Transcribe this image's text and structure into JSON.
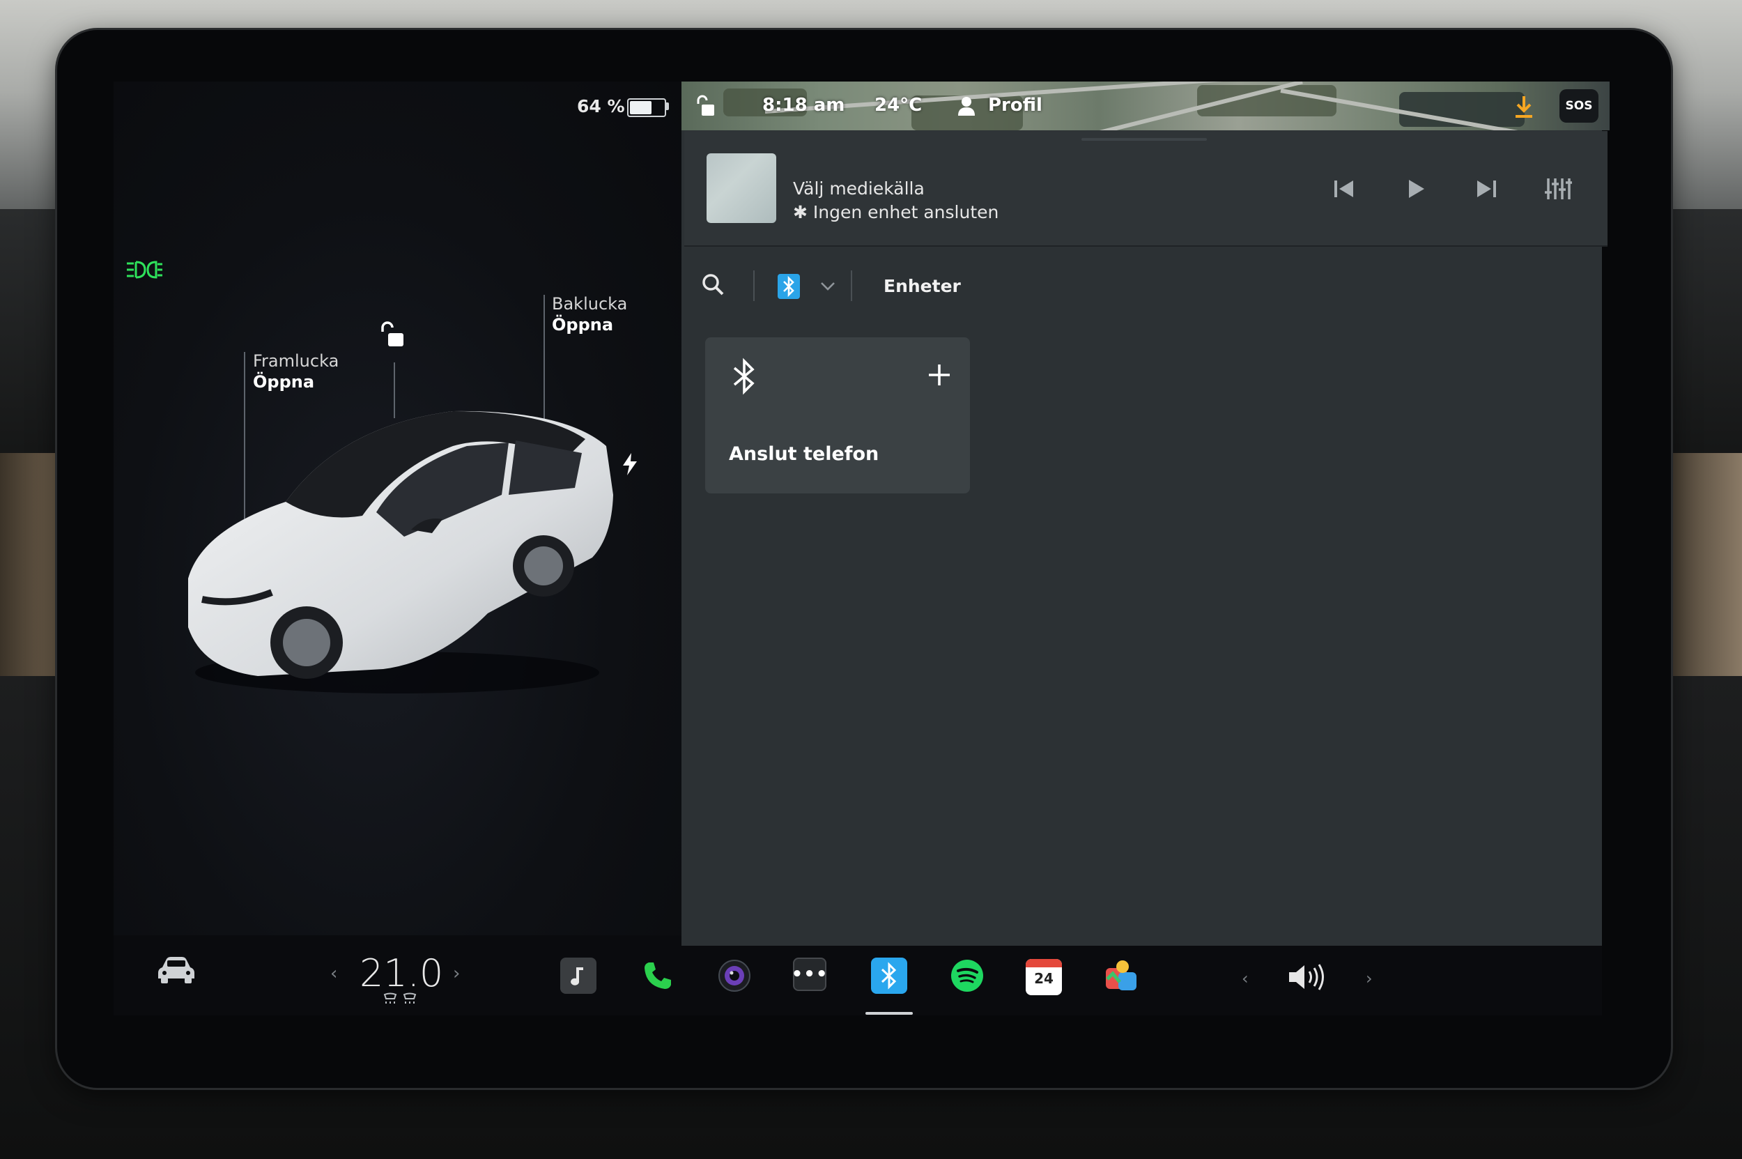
{
  "status": {
    "battery_percent_text": "64 %",
    "battery_level": 0.64,
    "time": "8:18 am",
    "temperature": "24°C",
    "profile": "Profil",
    "sos": "SOS"
  },
  "car_panel": {
    "frunk_label": "Framlucka",
    "frunk_action": "Öppna",
    "trunk_label": "Baklucka",
    "trunk_action": "Öppna"
  },
  "media": {
    "title": "Välj mediekälla",
    "subtitle": "Ingen enhet ansluten",
    "controls": [
      "skip-back-icon",
      "play-icon",
      "skip-forward-icon",
      "equalizer-icon"
    ]
  },
  "toolbar": {
    "devices_tab": "Enheter"
  },
  "pair_card": {
    "label": "Anslut telefon"
  },
  "dock": {
    "cabin_temp": "21.0",
    "calendar_day": "24",
    "apps": [
      "music-icon",
      "phone-icon",
      "camera-icon",
      "more-icon",
      "bluetooth-icon",
      "spotify-icon",
      "calendar-icon",
      "toybox-icon"
    ]
  },
  "colors": {
    "accent_blue": "#2aa7ee",
    "spotify_green": "#1ed760",
    "phone_green": "#2bd04d",
    "headlight_green": "#2ee25b",
    "download_orange": "#f5a623",
    "panel_bg": "#2c3134"
  }
}
